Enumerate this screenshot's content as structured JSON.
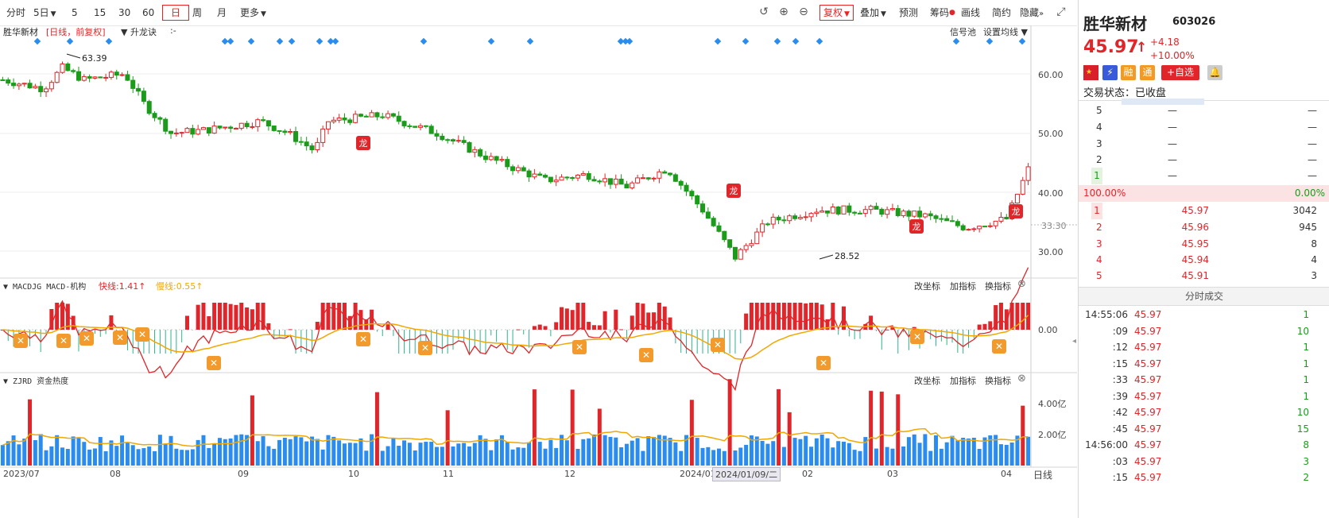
{
  "toolbar": {
    "fenshi": "分时",
    "period_5d": "5日",
    "min5": "5",
    "min15": "15",
    "min30": "30",
    "min60": "60",
    "day": "日",
    "week": "周",
    "month": "月",
    "more": "更多",
    "fuquan": "复权",
    "diejia": "叠加",
    "yuce": "预测",
    "chouma": "筹码",
    "huaxian": "画线",
    "jianyue": "简约",
    "yincang": "隐藏"
  },
  "kline": {
    "stock_name": "胜华新材",
    "tag": "[日线，前复权]",
    "indicator": "升龙诀",
    "indicator_value": ":-",
    "signal_pool": "信号池",
    "set_ma": "设置均线",
    "high_label": "63.39",
    "low_label": "28.52",
    "axis": [
      "60.00",
      "50.00",
      "40.00",
      "30.00"
    ],
    "current_price_label": "33.30",
    "dragon_mark": "龙"
  },
  "macd": {
    "title": "MACDJG MACD-机构",
    "fast_label": "快线:1.41↑",
    "slow_label": "慢线:0.55↑",
    "zero": "0.00",
    "change_coord": "改坐标",
    "add_ind": "加指标",
    "swap_ind": "换指标"
  },
  "zjrd": {
    "title": "ZJRD 资金热度",
    "axis": [
      "4.00亿",
      "2.00亿"
    ],
    "change_coord": "改坐标",
    "add_ind": "加指标",
    "swap_ind": "换指标"
  },
  "xaxis": {
    "labels": [
      "2023/07",
      "08",
      "09",
      "10",
      "11",
      "12",
      "2024/01",
      "02",
      "03",
      "04"
    ],
    "cursor_date": "2024/01/09/二",
    "period": "日线"
  },
  "quote": {
    "name": "胜华新材",
    "code": "603026",
    "price": "45.97",
    "arrow": "↑",
    "change": "+4.18",
    "change_pct": "+10.00%",
    "badges": [
      "融",
      "通"
    ],
    "add_watch": "+自选",
    "status": "交易状态：已收盘",
    "sell_levels": [
      {
        "lvl": "5",
        "price": "—",
        "vol": "—"
      },
      {
        "lvl": "4",
        "price": "—",
        "vol": "—"
      },
      {
        "lvl": "3",
        "price": "—",
        "vol": "—"
      },
      {
        "lvl": "2",
        "price": "—",
        "vol": "—"
      },
      {
        "lvl": "1",
        "price": "—",
        "vol": "—"
      }
    ],
    "ratio_left": "100.00%",
    "ratio_right": "0.00%",
    "buy_levels": [
      {
        "lvl": "1",
        "price": "45.97",
        "vol": "3042"
      },
      {
        "lvl": "2",
        "price": "45.96",
        "vol": "945"
      },
      {
        "lvl": "3",
        "price": "45.95",
        "vol": "8"
      },
      {
        "lvl": "4",
        "price": "45.94",
        "vol": "4"
      },
      {
        "lvl": "5",
        "price": "45.91",
        "vol": "3"
      }
    ],
    "ticks_title": "分时成交",
    "ticks": [
      {
        "t": "14:55:06",
        "p": "45.97",
        "v": "1"
      },
      {
        "t": ":09",
        "p": "45.97",
        "v": "10"
      },
      {
        "t": ":12",
        "p": "45.97",
        "v": "1"
      },
      {
        "t": ":15",
        "p": "45.97",
        "v": "1"
      },
      {
        "t": ":33",
        "p": "45.97",
        "v": "1"
      },
      {
        "t": ":39",
        "p": "45.97",
        "v": "1"
      },
      {
        "t": ":42",
        "p": "45.97",
        "v": "10"
      },
      {
        "t": ":45",
        "p": "45.97",
        "v": "15"
      },
      {
        "t": "14:56:00",
        "p": "45.97",
        "v": "8"
      },
      {
        "t": ":03",
        "p": "45.97",
        "v": "3"
      },
      {
        "t": ":15",
        "p": "45.97",
        "v": "2"
      }
    ]
  },
  "colors": {
    "up": "#e0262a",
    "down": "#1a9b1a",
    "macd_fast": "#e0262a",
    "macd_slow": "#f0a800",
    "vol_blue": "#2b8cf0",
    "signal": "#2b8cf0"
  }
}
